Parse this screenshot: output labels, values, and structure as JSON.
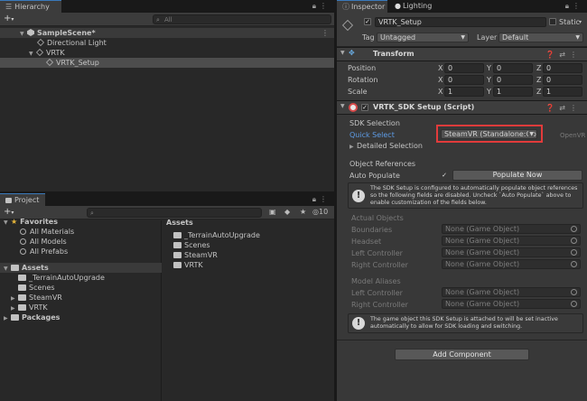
{
  "hierarchy": {
    "tab": "Hierarchy",
    "search_placeholder": "All",
    "items": [
      {
        "label": "SampleScene*"
      },
      {
        "label": "Directional Light"
      },
      {
        "label": "VRTK"
      },
      {
        "label": "VRTK_Setup"
      }
    ]
  },
  "project": {
    "tab": "Project",
    "count": "10",
    "favorites": {
      "label": "Favorites",
      "items": [
        "All Materials",
        "All Models",
        "All Prefabs"
      ]
    },
    "assets_tree": {
      "label": "Assets",
      "items": [
        "_TerrainAutoUpgrade",
        "Scenes",
        "SteamVR",
        "VRTK"
      ]
    },
    "packages_label": "Packages",
    "assets_pane": {
      "title": "Assets",
      "items": [
        "_TerrainAutoUpgrade",
        "Scenes",
        "SteamVR",
        "VRTK"
      ]
    }
  },
  "inspector": {
    "tabs": [
      "Inspector",
      "Lighting"
    ],
    "object_name": "VRTK_Setup",
    "static_label": "Static",
    "tag_label": "Tag",
    "tag_value": "Untagged",
    "layer_label": "Layer",
    "layer_value": "Default",
    "transform": {
      "title": "Transform",
      "rows": [
        {
          "label": "Position",
          "x": "0",
          "y": "0",
          "z": "0"
        },
        {
          "label": "Rotation",
          "x": "0",
          "y": "0",
          "z": "0"
        },
        {
          "label": "Scale",
          "x": "1",
          "y": "1",
          "z": "1"
        }
      ],
      "axis": {
        "x": "X",
        "y": "Y",
        "z": "Z"
      }
    },
    "sdk_setup": {
      "title": "VRTK_SDK Setup (Script)",
      "sdk_selection_label": "SDK Selection",
      "quick_select_label": "Quick Select",
      "quick_select_value": "SteamVR (Standalone:Ope",
      "openvr_label": "OpenVR",
      "detailed_selection_label": "Detailed Selection",
      "object_references_label": "Object References",
      "auto_populate_label": "Auto Populate",
      "populate_now_label": "Populate Now",
      "info_text": "The SDK Setup is configured to automatically populate object references so the following fields are disabled. Uncheck `Auto Populate` above to enable customization of the fields below.",
      "actual_objects_label": "Actual Objects",
      "actual_objects": [
        {
          "label": "Boundaries",
          "value": "None (Game Object)"
        },
        {
          "label": "Headset",
          "value": "None (Game Object)"
        },
        {
          "label": "Left Controller",
          "value": "None (Game Object)"
        },
        {
          "label": "Right Controller",
          "value": "None (Game Object)"
        }
      ],
      "model_aliases_label": "Model Aliases",
      "model_aliases": [
        {
          "label": "Left Controller",
          "value": "None (Game Object)"
        },
        {
          "label": "Right Controller",
          "value": "None (Game Object)"
        }
      ],
      "bottom_info_text": "The game object this SDK Setup is attached to will be set inactive automatically to allow for SDK loading and switching."
    },
    "add_component_label": "Add Component"
  },
  "colors": {
    "accent": "#3a79bb",
    "highlight_box": "#e23b3b",
    "link_blue": "#5e9ce6"
  }
}
